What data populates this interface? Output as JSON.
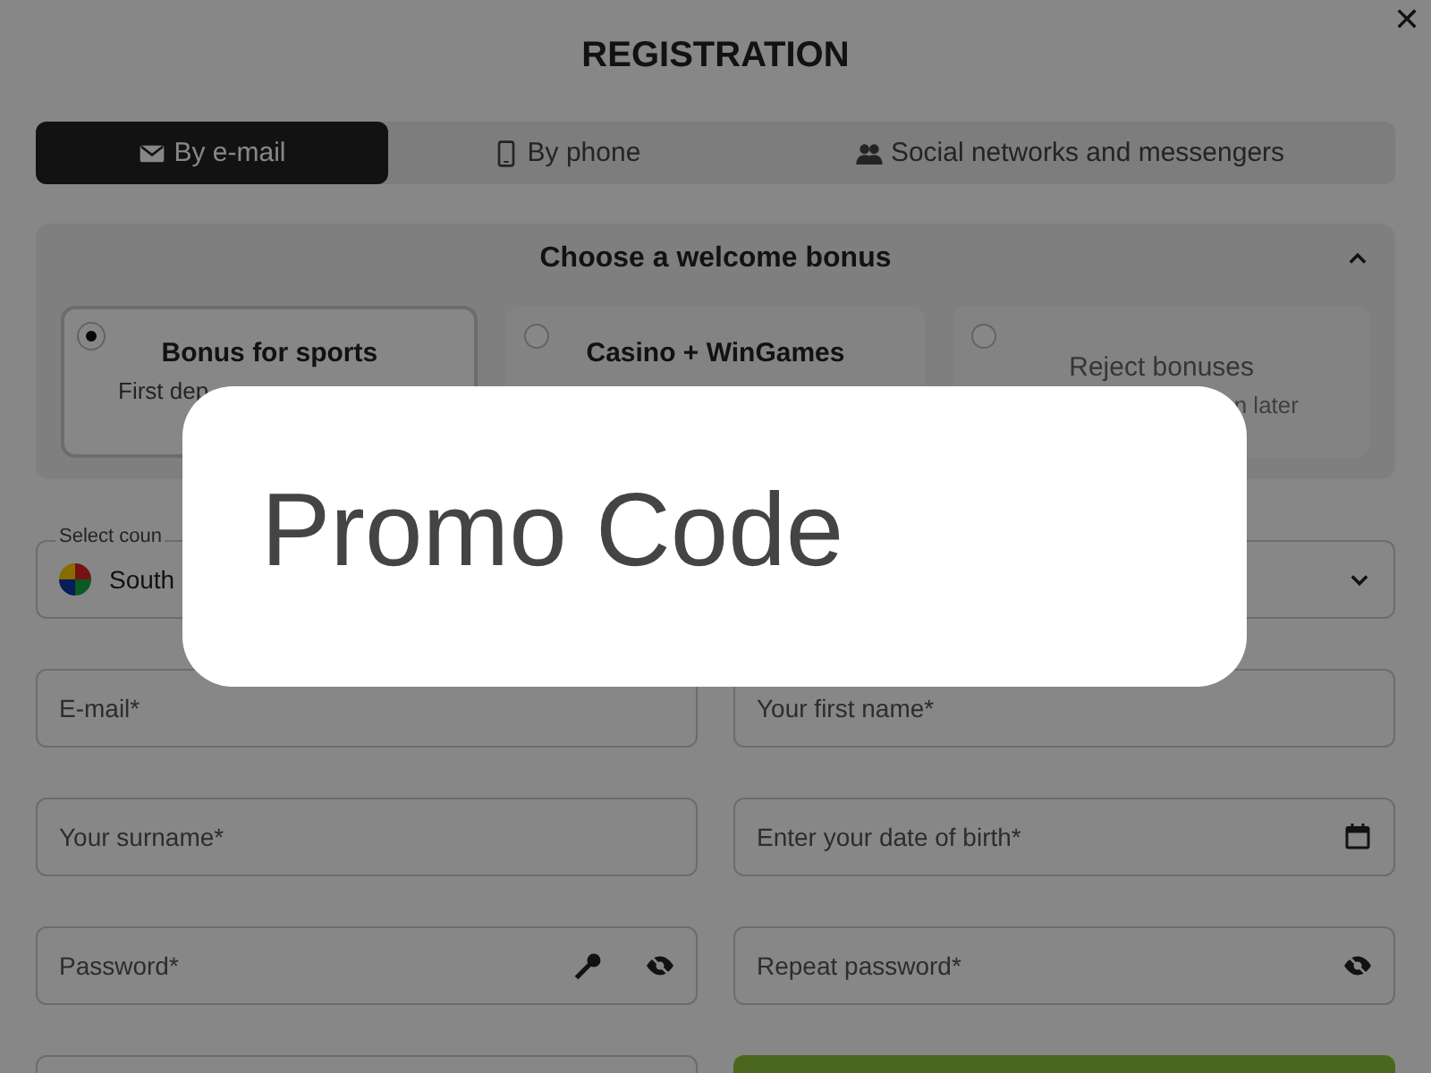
{
  "dialog": {
    "title": "REGISTRATION",
    "close": "✕"
  },
  "tabs": [
    {
      "label": "By e-mail",
      "selected": true
    },
    {
      "label": "By phone",
      "selected": false
    },
    {
      "label": "Social networks and messengers",
      "selected": false
    }
  ],
  "bonus": {
    "title": "Choose a welcome bonus",
    "expanded": true,
    "options": [
      {
        "title": "Bonus for sports",
        "subtitle": "First dep",
        "selected": true
      },
      {
        "title": "Casino + WinGames",
        "selected": false
      },
      {
        "title": "Reject bonuses",
        "subtitle": "n later",
        "selected": false
      }
    ]
  },
  "selects": [
    {
      "label": "Select coun",
      "value": "South"
    },
    {
      "expanded": false
    }
  ],
  "fields": [
    {
      "placeholder": "E-mail*",
      "kind": "text"
    },
    {
      "placeholder": "Your first name*",
      "kind": "text"
    },
    {
      "placeholder": "Your surname*",
      "kind": "text"
    },
    {
      "placeholder": "Enter your date of birth*",
      "kind": "date"
    },
    {
      "placeholder": "Password*",
      "kind": "password"
    },
    {
      "placeholder": "Repeat password*",
      "kind": "repeat"
    },
    {
      "kind": "text"
    },
    {
      "kind": "button"
    }
  ],
  "popup": {
    "text": "Promo Code"
  }
}
